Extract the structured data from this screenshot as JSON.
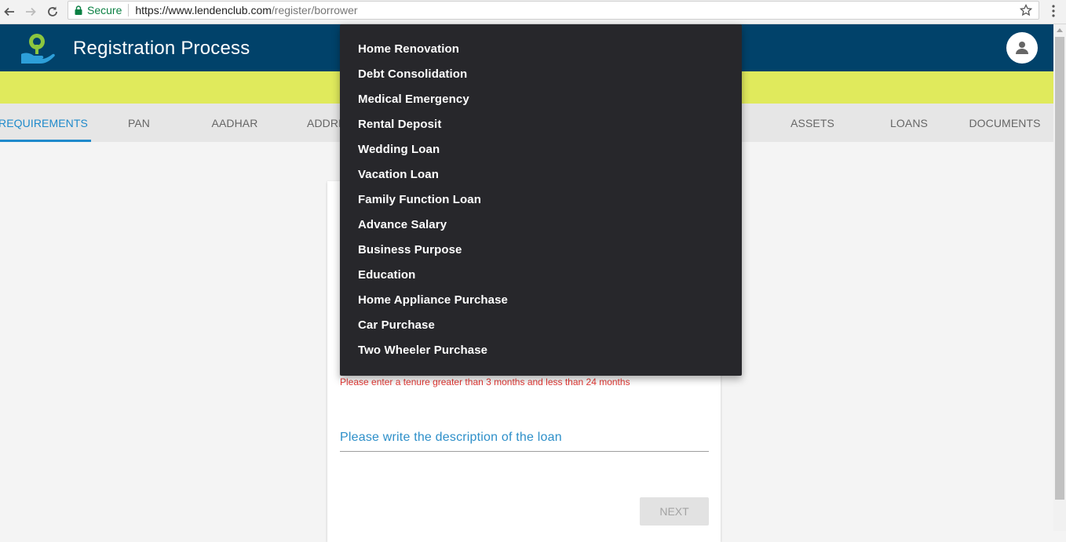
{
  "browser": {
    "secure_label": "Secure",
    "url_host": "https://www.lendenclub.com",
    "url_path": "/register/borrower"
  },
  "header": {
    "title": "Registration Process"
  },
  "tabs": [
    {
      "label": "REQUIREMENTS",
      "active": true
    },
    {
      "label": "PAN"
    },
    {
      "label": "AADHAR"
    },
    {
      "label": "ADDRE"
    },
    {
      "label": "ASSETS"
    },
    {
      "label": "LOANS"
    },
    {
      "label": "DOCUMENTS"
    }
  ],
  "dropdown": {
    "options": [
      "Home Renovation",
      "Debt Consolidation",
      "Medical Emergency",
      "Rental Deposit",
      "Wedding Loan",
      "Vacation Loan",
      "Family Function Loan",
      "Advance Salary",
      "Business Purpose",
      "Education",
      "Home Appliance Purchase",
      "Car Purchase",
      "Two Wheeler Purchase"
    ]
  },
  "form": {
    "tenure_error": "Please enter a tenure greater than 3 months and less than 24 months",
    "description_placeholder": "Please write the description of the loan",
    "next_label": "NEXT"
  },
  "colors": {
    "header_bg": "#01426a",
    "banner": "#e0ea5c",
    "accent": "#1f8acb",
    "error": "#e53935",
    "dropdown_bg": "#27272b"
  }
}
